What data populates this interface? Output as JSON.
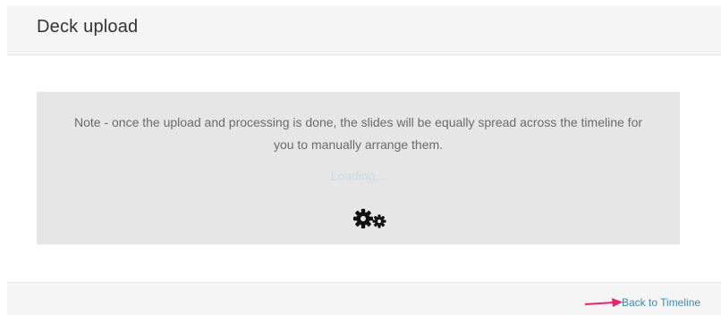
{
  "header": {
    "title": "Deck upload"
  },
  "main": {
    "note_line1": "Note - once the upload and processing is done, the slides will be equally spread across the timeline for",
    "note_line2": "you to manually arrange them.",
    "loading": "Loading...",
    "loading_icon": "gears-icon"
  },
  "footer": {
    "back_link": "Back to Timeline",
    "annotation_icon": "arrow-right-icon"
  },
  "colors": {
    "link": "#3a8bb3",
    "annotation_arrow": "#e8246e",
    "note_box": "#e6e6e6",
    "header_bg": "#f5f5f5"
  }
}
